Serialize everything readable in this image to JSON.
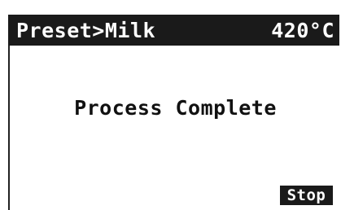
{
  "header": {
    "title": "Preset>Milk",
    "temperature": "420°C"
  },
  "main": {
    "status_message": "Process Complete"
  },
  "controls": {
    "stop_label": "Stop"
  },
  "colors": {
    "background": "#ffffff",
    "bar": "#1a1a1a",
    "text": "#111111",
    "inverse_text": "#ffffff"
  }
}
